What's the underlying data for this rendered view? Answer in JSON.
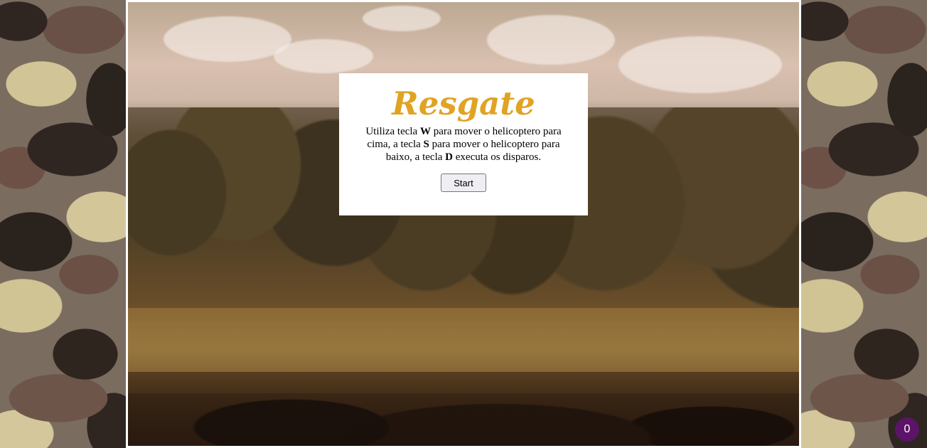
{
  "title": "Resgate",
  "instructions": {
    "part1": "Utiliza tecla ",
    "key_w": "W",
    "part2": " para mover o helicoptero para cima, a tecla ",
    "key_s": "S",
    "part3": " para mover o helicoptero para baixo, a tecla ",
    "key_d": "D",
    "part4": " executa os disparos."
  },
  "start_label": "Start",
  "score": "0",
  "colors": {
    "title_accent": "#e1a323",
    "badge": "#5b1467"
  },
  "icons": {
    "background": "camouflage-pattern"
  }
}
